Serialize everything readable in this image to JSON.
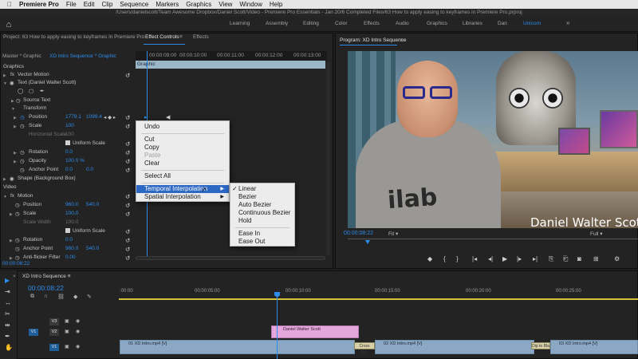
{
  "menubar": {
    "apple": "",
    "app": "Premiere Pro",
    "items": [
      "File",
      "Edit",
      "Clip",
      "Sequence",
      "Markers",
      "Graphics",
      "View",
      "Window",
      "Help"
    ]
  },
  "title": "/Users/danielscott/Team Awesome Dropbox/Daniel Scott/Video - Premiere Pro Essentials - Jan 20/6 Completed Files/63 How to apply easing to keyframes in Premiere Pro.prproj",
  "workspaces": [
    "Learning",
    "Assembly",
    "Editing",
    "Color",
    "Effects",
    "Audio",
    "Graphics",
    "Libraries",
    "Dan",
    "Unicorn"
  ],
  "workspace_active": "Unicorn",
  "workspace_more": "»",
  "panel_tabs": {
    "project": "Project: 63 How to apply easing to keyframes in Premiere Pro",
    "effect_controls": "Effect Controls",
    "effects": "Effects",
    "menu_glyph": "≡"
  },
  "effect_controls": {
    "master": "Master * Graphic",
    "sequence_clip": "XD Intro Sequence * Graphic",
    "ruler": [
      "00:00:09:00",
      "00:00:10:00",
      "00:00:11:00",
      "00:00:12:00",
      "00:00:13:00"
    ],
    "clip_label": "Graphic",
    "rows": {
      "graphics": "Graphics",
      "vector_motion": "Vector Motion",
      "text_layer": "Text (Daniel Walter Scott)",
      "source_text": "Source Text",
      "transform": "Transform",
      "position": "Position",
      "position_x": "1779.1",
      "position_y": "1099.4",
      "scale": "Scale",
      "scale_val": "100",
      "hscale": "Horizontal Scale",
      "hscale_val": "100",
      "uniform_scale": "Uniform Scale",
      "rotation": "Rotation",
      "rotation_val": "0.0",
      "opacity": "Opacity",
      "opacity_val": "100.0 %",
      "anchor": "Anchor Point",
      "anchor_x": "0.0",
      "anchor_y": "0.0",
      "shape": "Shape (Background Box)",
      "video": "Video",
      "motion": "Motion",
      "m_position": "Position",
      "m_position_x": "960.0",
      "m_position_y": "540.0",
      "m_scale": "Scale",
      "m_scale_val": "100.0",
      "m_scale_width": "Scale Width",
      "m_scale_width_val": "100.0",
      "m_uniform": "Uniform Scale",
      "m_rotation": "Rotation",
      "m_rotation_val": "0.0",
      "m_anchor": "Anchor Point",
      "m_anchor_x": "960.0",
      "m_anchor_y": "540.0",
      "antiflicker": "Anti-flicker Filter",
      "antiflicker_val": "0.00"
    },
    "timecode": "00:00:08:22"
  },
  "context_menu": {
    "undo": "Undo",
    "cut": "Cut",
    "copy": "Copy",
    "paste": "Paste",
    "clear": "Clear",
    "select_all": "Select All",
    "temporal": "Temporal Interpolation",
    "spatial": "Spatial Interpolation"
  },
  "submenu": {
    "linear": "Linear",
    "bezier": "Bezier",
    "auto_bezier": "Auto Bezier",
    "continuous_bezier": "Continuous Bezier",
    "hold": "Hold",
    "ease_in": "Ease In",
    "ease_out": "Ease Out",
    "checked": "✓"
  },
  "program": {
    "title": "Program: XD Intro Sequence",
    "caption": "Daniel Walter Scott",
    "shirt_text": "ilab",
    "timecode": "00:00:08:22",
    "fit": "Fit",
    "full": "Full"
  },
  "timeline": {
    "tab": "XD Intro Sequence",
    "timecode": "00:00:08:22",
    "ruler": [
      ":00:00",
      "00:00:05:00",
      "00:00:10:00",
      "00:00:15:00",
      "00:00:20:00",
      "00:00:25:00"
    ],
    "tracks": {
      "v3": "V3",
      "v2": "V2",
      "v1": "V1",
      "src_v1": "V1"
    },
    "graphic_clip": "Daniel Walter Scott",
    "clips": [
      "01 XD Intro.mp4 [V]",
      "02 XD Intro.mp4 [V]",
      "03 XD Intro.mp4 [V]"
    ],
    "transitions": [
      "Cross Diss",
      "Dip to Bla"
    ]
  },
  "colors": {
    "accent": "#2d8ceb",
    "graphic_clip": "#e4a6dc",
    "video_clip": "#8aa8c4"
  }
}
